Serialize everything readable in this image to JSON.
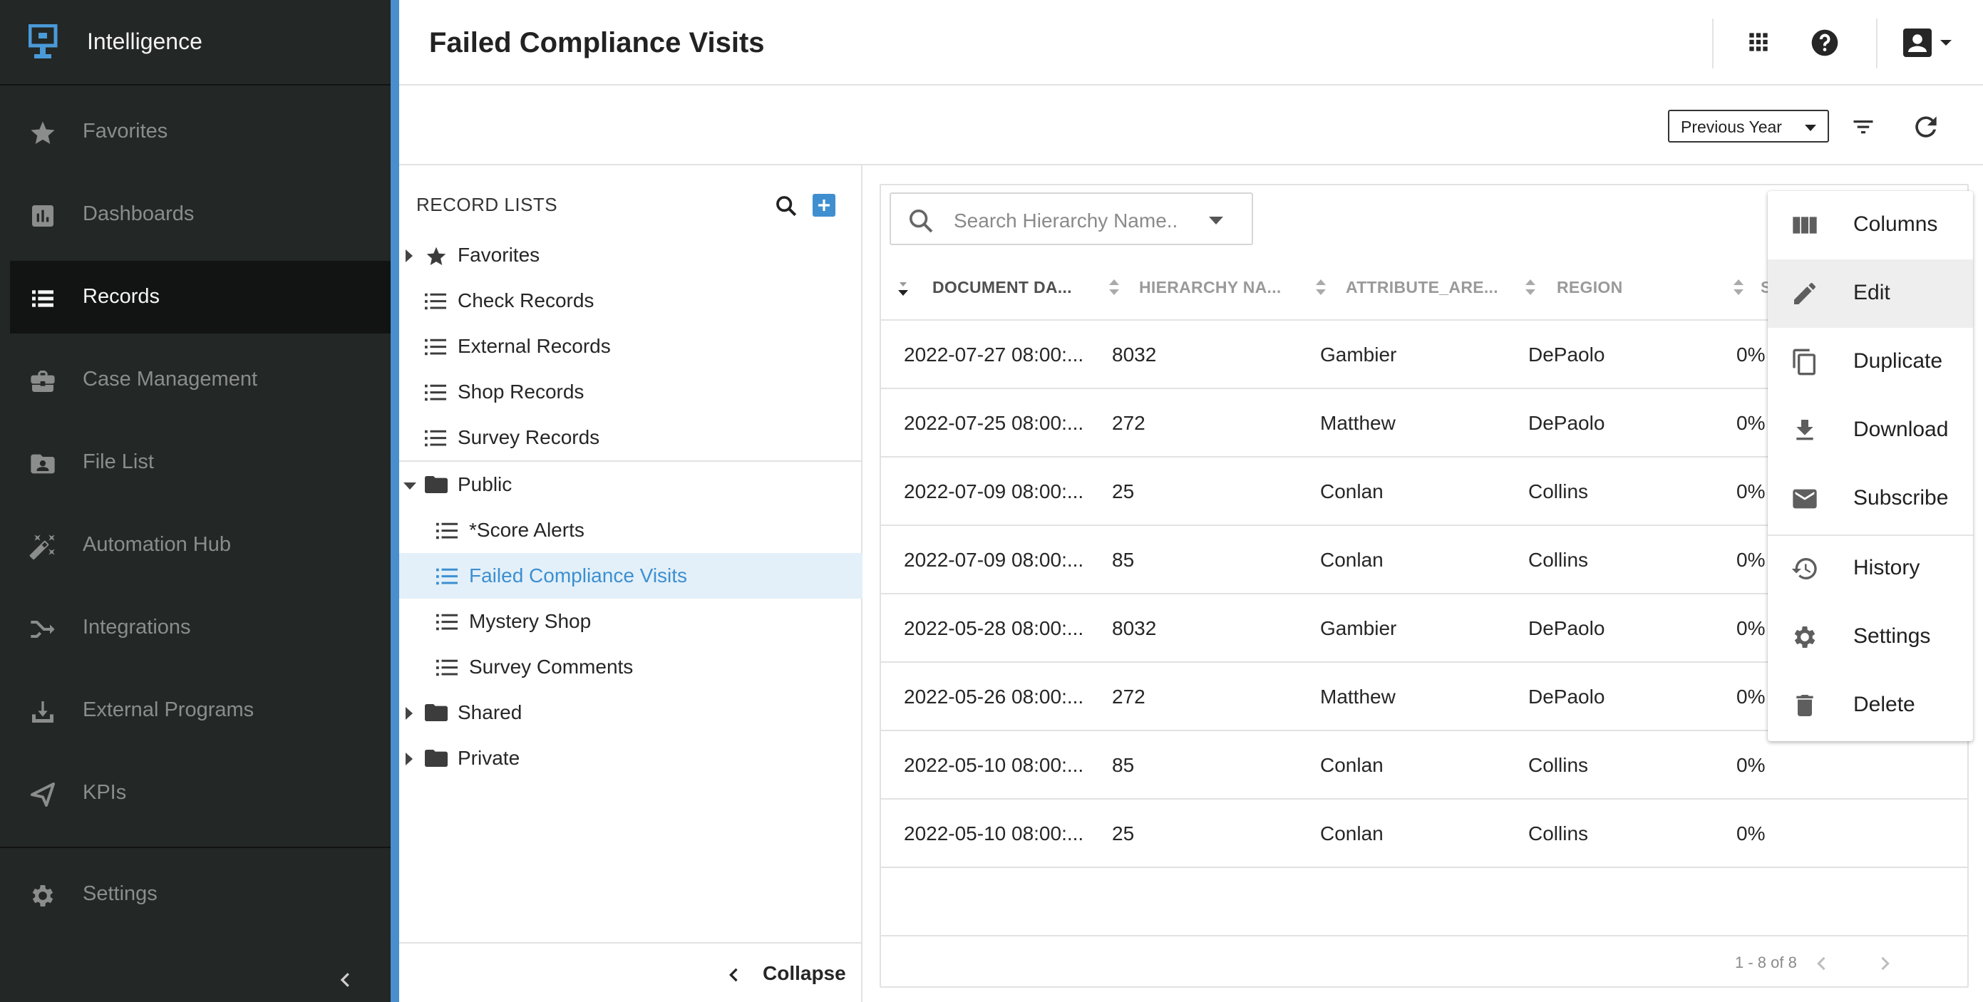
{
  "app": {
    "name": "Intelligence",
    "accent": "#4a8fcd",
    "sidebar_bg": "#232725"
  },
  "sidebar": {
    "items": [
      {
        "label": "Favorites",
        "icon": "star-icon"
      },
      {
        "label": "Dashboards",
        "icon": "bar-chart-icon"
      },
      {
        "label": "Records",
        "icon": "list-icon",
        "active": true
      },
      {
        "label": "Case Management",
        "icon": "briefcase-icon"
      },
      {
        "label": "File List",
        "icon": "folder-user-icon"
      },
      {
        "label": "Automation Hub",
        "icon": "magic-wand-icon"
      },
      {
        "label": "Integrations",
        "icon": "merge-arrow-icon"
      },
      {
        "label": "External Programs",
        "icon": "download-tray-icon"
      },
      {
        "label": "KPIs",
        "icon": "send-icon"
      }
    ],
    "settings_label": "Settings"
  },
  "header": {
    "title": "Failed Compliance Visits"
  },
  "toolbar": {
    "period": "Previous Year"
  },
  "record_lists": {
    "title": "RECORD LISTS",
    "favorites": "Favorites",
    "lists": [
      "Check Records",
      "External Records",
      "Shop Records",
      "Survey Records"
    ],
    "public_folder": "Public",
    "public_items": [
      "*Score Alerts",
      "Failed Compliance Visits",
      "Mystery Shop",
      "Survey Comments"
    ],
    "shared_folder": "Shared",
    "private_folder": "Private",
    "collapse": "Collapse"
  },
  "grid": {
    "search_placeholder": "Search Hierarchy Name..",
    "columns": [
      "DOCUMENT DA...",
      "HIERARCHY NA...",
      "ATTRIBUTE_ARE...",
      "REGION",
      "S"
    ],
    "rows": [
      [
        "2022-07-27 08:00:...",
        "8032",
        "Gambier",
        "DePaolo",
        "0%"
      ],
      [
        "2022-07-25 08:00:...",
        "272",
        "Matthew",
        "DePaolo",
        "0%"
      ],
      [
        "2022-07-09 08:00:...",
        "25",
        "Conlan",
        "Collins",
        "0%"
      ],
      [
        "2022-07-09 08:00:...",
        "85",
        "Conlan",
        "Collins",
        "0%"
      ],
      [
        "2022-05-28 08:00:...",
        "8032",
        "Gambier",
        "DePaolo",
        "0%"
      ],
      [
        "2022-05-26 08:00:...",
        "272",
        "Matthew",
        "DePaolo",
        "0%"
      ],
      [
        "2022-05-10 08:00:...",
        "85",
        "Conlan",
        "Collins",
        "0%"
      ],
      [
        "2022-05-10 08:00:...",
        "25",
        "Conlan",
        "Collins",
        "0%"
      ]
    ],
    "pagination": "1 - 8 of 8"
  },
  "menu": {
    "items": [
      {
        "label": "Columns",
        "icon": "columns-icon"
      },
      {
        "label": "Edit",
        "icon": "pencil-icon"
      },
      {
        "label": "Duplicate",
        "icon": "copy-icon"
      },
      {
        "label": "Download",
        "icon": "download-icon"
      },
      {
        "label": "Subscribe",
        "icon": "mail-icon"
      },
      {
        "label": "History",
        "icon": "history-icon"
      },
      {
        "label": "Settings",
        "icon": "gear-icon"
      },
      {
        "label": "Delete",
        "icon": "trash-icon"
      }
    ]
  }
}
